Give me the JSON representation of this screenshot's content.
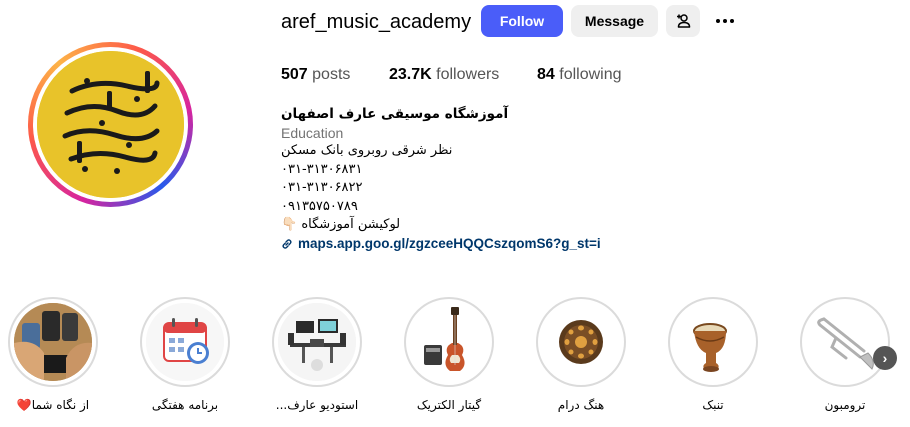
{
  "profile": {
    "username": "aref_music_academy",
    "logo_text": "آموزشگاه موسیقی عارف",
    "follow_label": "Follow",
    "message_label": "Message",
    "suggest_icon": "add-person-icon",
    "more_icon": "more-options-icon"
  },
  "stats": {
    "posts_count": "507",
    "posts_label": "posts",
    "followers_count": "23.7K",
    "followers_label": "followers",
    "following_count": "84",
    "following_label": "following"
  },
  "bio": {
    "name": "آموزشگاه موسیقی عارف اصفهان",
    "category": "Education",
    "line1": "نظر شرقی روبروی بانک مسکن",
    "line2": "۰۳۱-۳۱۳۰۶۸۳۱",
    "line3": "۰۳۱-۳۱۳۰۶۸۲۲",
    "line4": "۰۹۱۳۵۷۵۰۷۸۹",
    "line5": "لوکیشن آموزشگاه 👇🏻",
    "link": "maps.app.goo.gl/zgzceeHQQCszqomS6?g_st=i"
  },
  "highlights": [
    {
      "label": "از نگاه شما❤️",
      "icon": "phones-photo-icon"
    },
    {
      "label": "برنامه هفتگی",
      "icon": "calendar-icon"
    },
    {
      "label": "استودیو عارف...",
      "icon": "studio-icon"
    },
    {
      "label": "گیتار الکتریک",
      "icon": "electric-guitar-icon"
    },
    {
      "label": "هنگ درام",
      "icon": "hang-drum-icon"
    },
    {
      "label": "تنبک",
      "icon": "tonbak-drum-icon"
    },
    {
      "label": "ترومبون",
      "icon": "trombone-icon"
    }
  ],
  "colors": {
    "follow_button": "#4a5df9",
    "secondary_button": "#efefef",
    "link": "#00376b",
    "logo_background": "#e8c32a"
  }
}
